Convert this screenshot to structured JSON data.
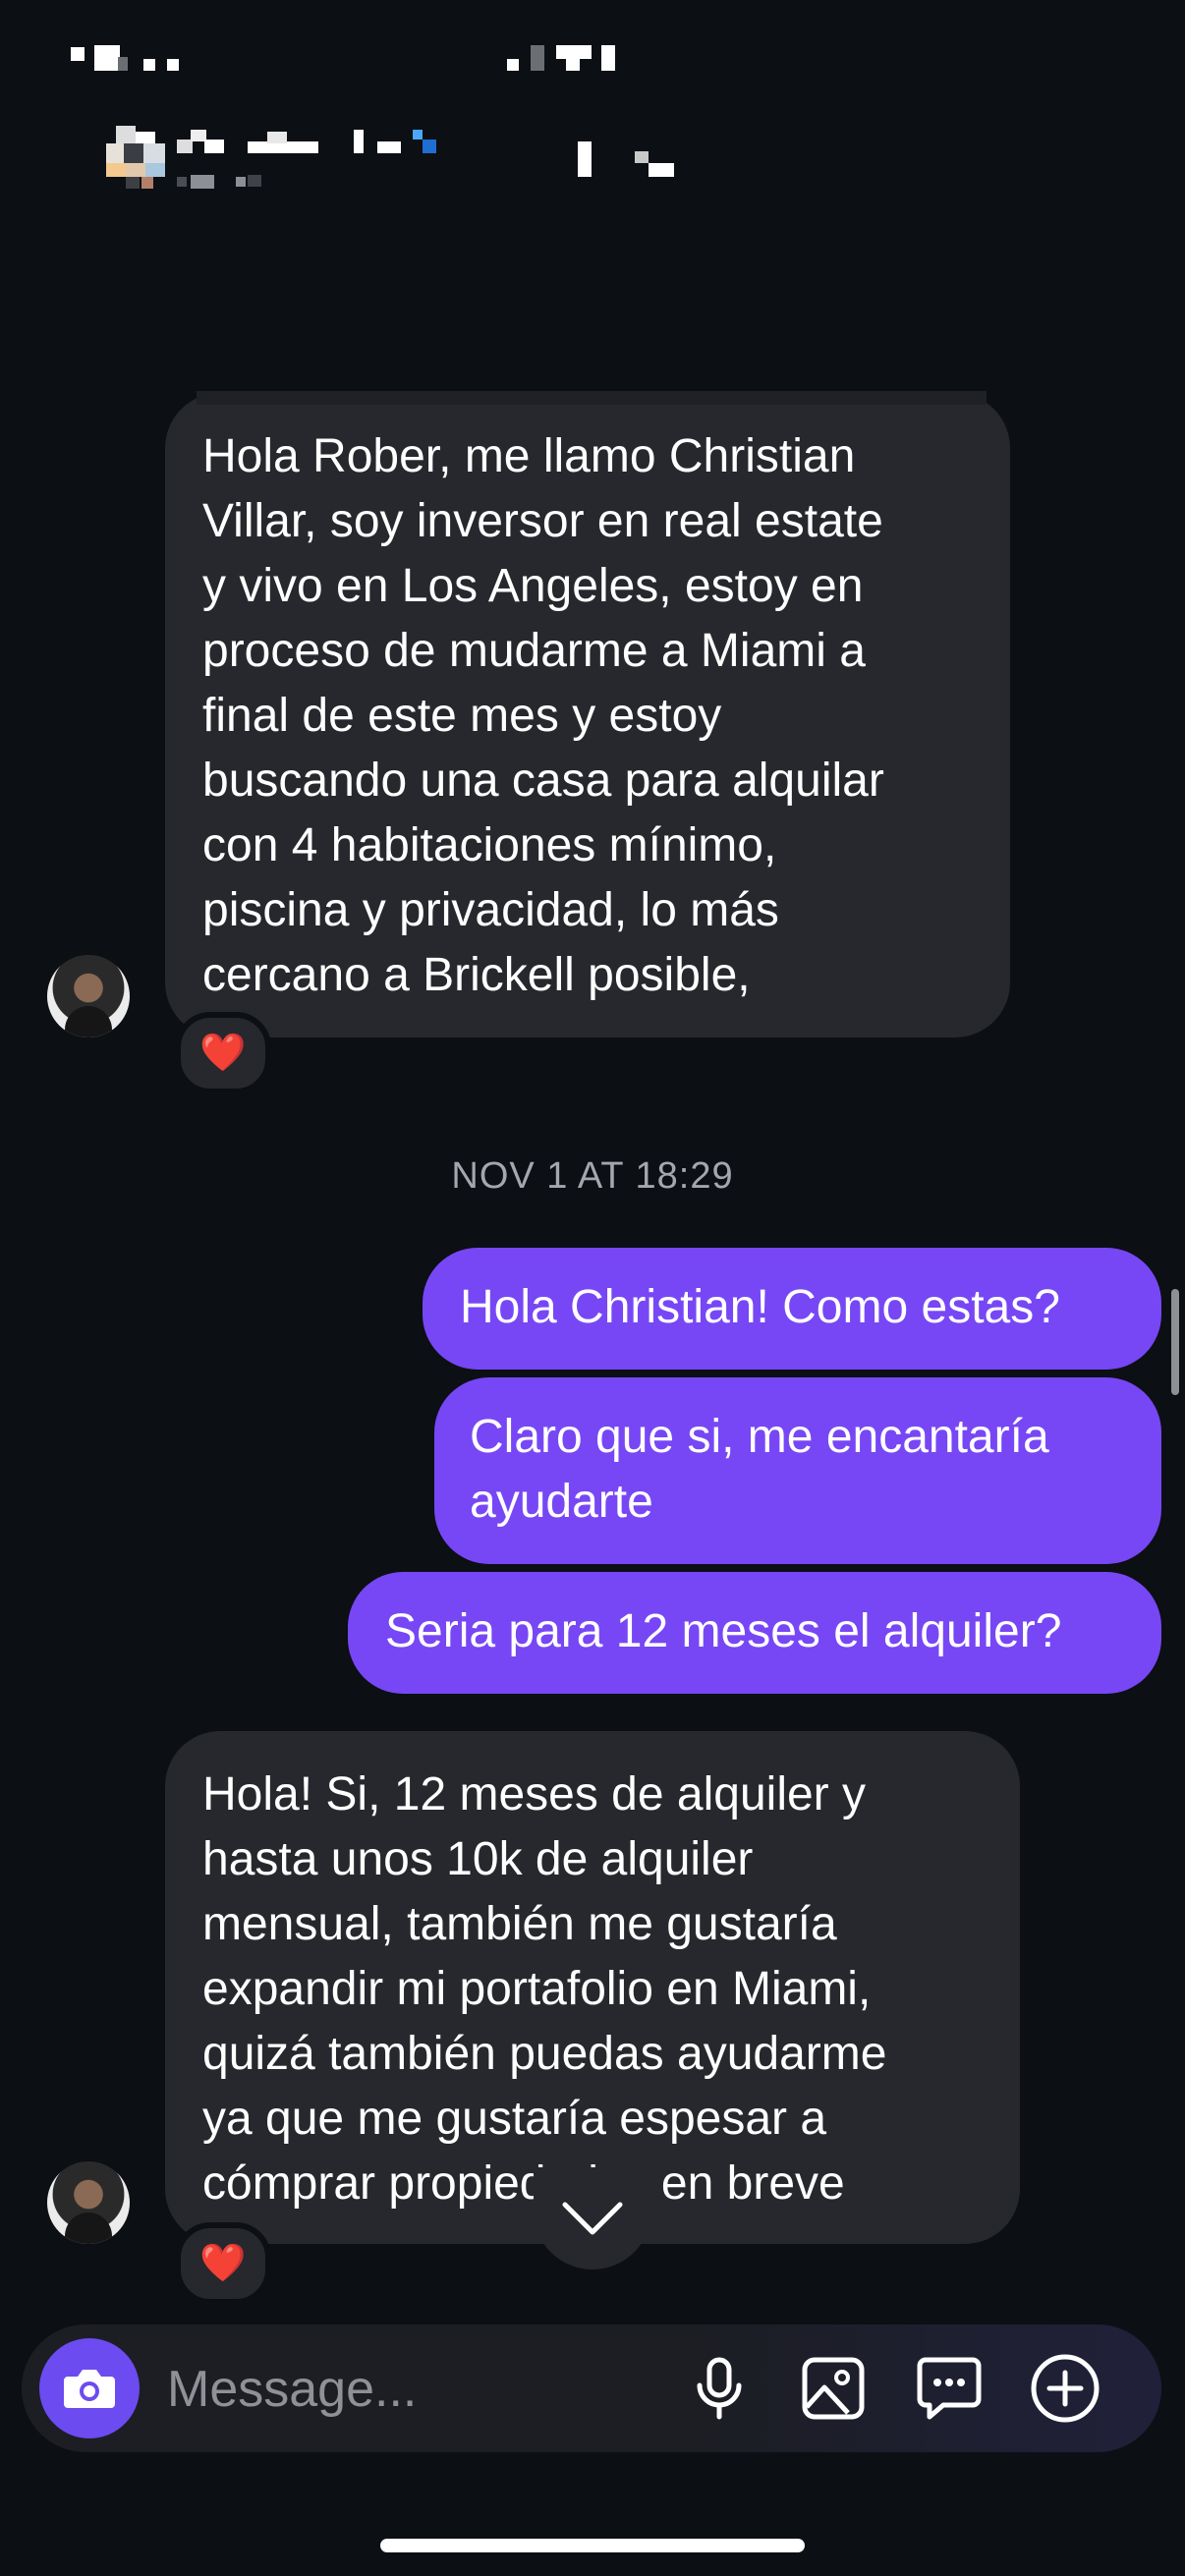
{
  "messages": {
    "incoming_1": {
      "lines": [
        "Hola Rober, me llamo Christian",
        "Villar, soy inversor en real estate",
        "y vivo en Los Angeles, estoy en",
        "proceso de mudarme a Miami a",
        "final de este mes y estoy",
        "buscando una casa para alquilar",
        "con 4 habitaciones mínimo,",
        "piscina y privacidad, lo más",
        "cercano a Brickell posible,"
      ],
      "reaction": "❤️"
    },
    "timestamp": "NOV 1 AT 18:29",
    "outgoing_1": "Hola Christian! Como estas?",
    "outgoing_2": [
      "Claro que si, me encantaría",
      "ayudarte"
    ],
    "outgoing_3": "Seria para 12 meses el alquiler?",
    "incoming_2": {
      "lines": [
        "Hola! Si, 12 meses de alquiler y",
        "hasta unos 10k de alquiler",
        "mensual, también me gustaría",
        "expandir mi portafolio en Miami,",
        "quizá también puedas ayudarme",
        "ya que me gustaría espesar a",
        "cómprar propiedades en breve"
      ],
      "reaction": "❤️"
    }
  },
  "composer": {
    "placeholder": "Message...",
    "icons": [
      "camera-icon",
      "microphone-icon",
      "gallery-icon",
      "sticker-chat-icon",
      "add-icon"
    ]
  },
  "colors": {
    "background": "#0c0f14",
    "incoming_bubble": "#26282d",
    "outgoing_bubble": "#7747f5",
    "camera_button": "#6c4bf0"
  }
}
